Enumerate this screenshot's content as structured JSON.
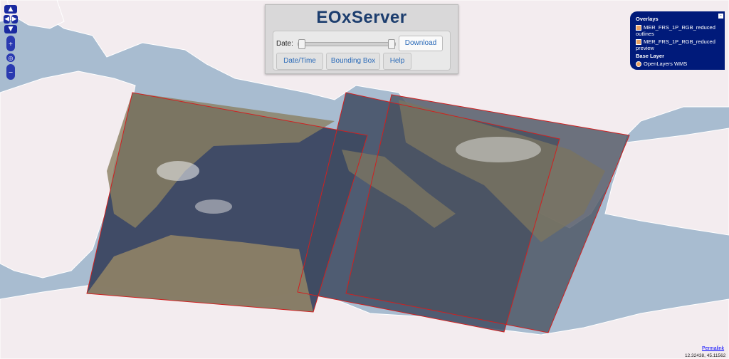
{
  "header": {
    "title": "EOxServer"
  },
  "controls": {
    "date_label": "Date:",
    "date_range": {
      "start_fraction": 0.0,
      "end_fraction": 1.0
    },
    "download_label": "Download",
    "tabs": [
      {
        "label": "Date/Time"
      },
      {
        "label": "Bounding Box"
      },
      {
        "label": "Help"
      }
    ]
  },
  "layer_switcher": {
    "overlays_title": "Overlays",
    "overlays": [
      {
        "label": "MER_FRS_1P_RGB_reduced outlines",
        "checked": true
      },
      {
        "label": "MER_FRS_1P_RGB_reduced preview",
        "checked": true
      }
    ],
    "base_title": "Base Layer",
    "base_layers": [
      {
        "label": "OpenLayers WMS",
        "selected": true
      }
    ],
    "minimize_label": "-"
  },
  "footer": {
    "permalink": "Permalink",
    "coordinates": "12.32438, 45.11562"
  },
  "icons": [
    "pan-up-icon",
    "pan-left-icon",
    "pan-right-icon",
    "pan-down-icon",
    "zoom-in-icon",
    "zoom-world-icon",
    "zoom-out-icon"
  ],
  "colors": {
    "accent": "#001a7a",
    "outline": "#d02020",
    "water": "#a8bcd0",
    "land": "#f3ecef"
  }
}
